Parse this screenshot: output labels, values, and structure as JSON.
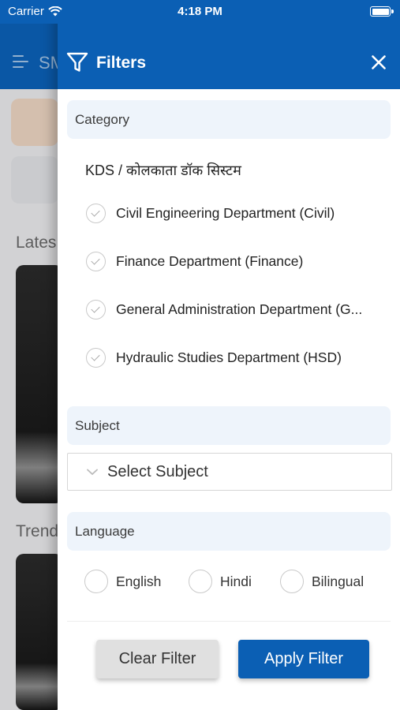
{
  "status_bar": {
    "carrier": "Carrier",
    "time": "4:18 PM"
  },
  "background": {
    "app_name": "SM",
    "sections": [
      "Lates",
      "Trend"
    ]
  },
  "drawer": {
    "title": "Filters",
    "category": {
      "heading": "Category",
      "organization": "KDS / कोलकाता डॉक सिस्टम",
      "items": [
        {
          "label": "Civil Engineering Department (Civil)"
        },
        {
          "label": "Finance Department (Finance)"
        },
        {
          "label": "General Administration Department (G..."
        },
        {
          "label": "Hydraulic Studies Department (HSD)"
        }
      ]
    },
    "subject": {
      "heading": "Subject",
      "placeholder": "Select Subject"
    },
    "language": {
      "heading": "Language",
      "options": [
        "English",
        "Hindi",
        "Bilingual"
      ]
    },
    "buttons": {
      "clear_label": "Clear Filter",
      "apply_label": "Apply Filter"
    }
  },
  "colors": {
    "brand": "#0b5fb4",
    "section_bg": "#eef4fb"
  }
}
